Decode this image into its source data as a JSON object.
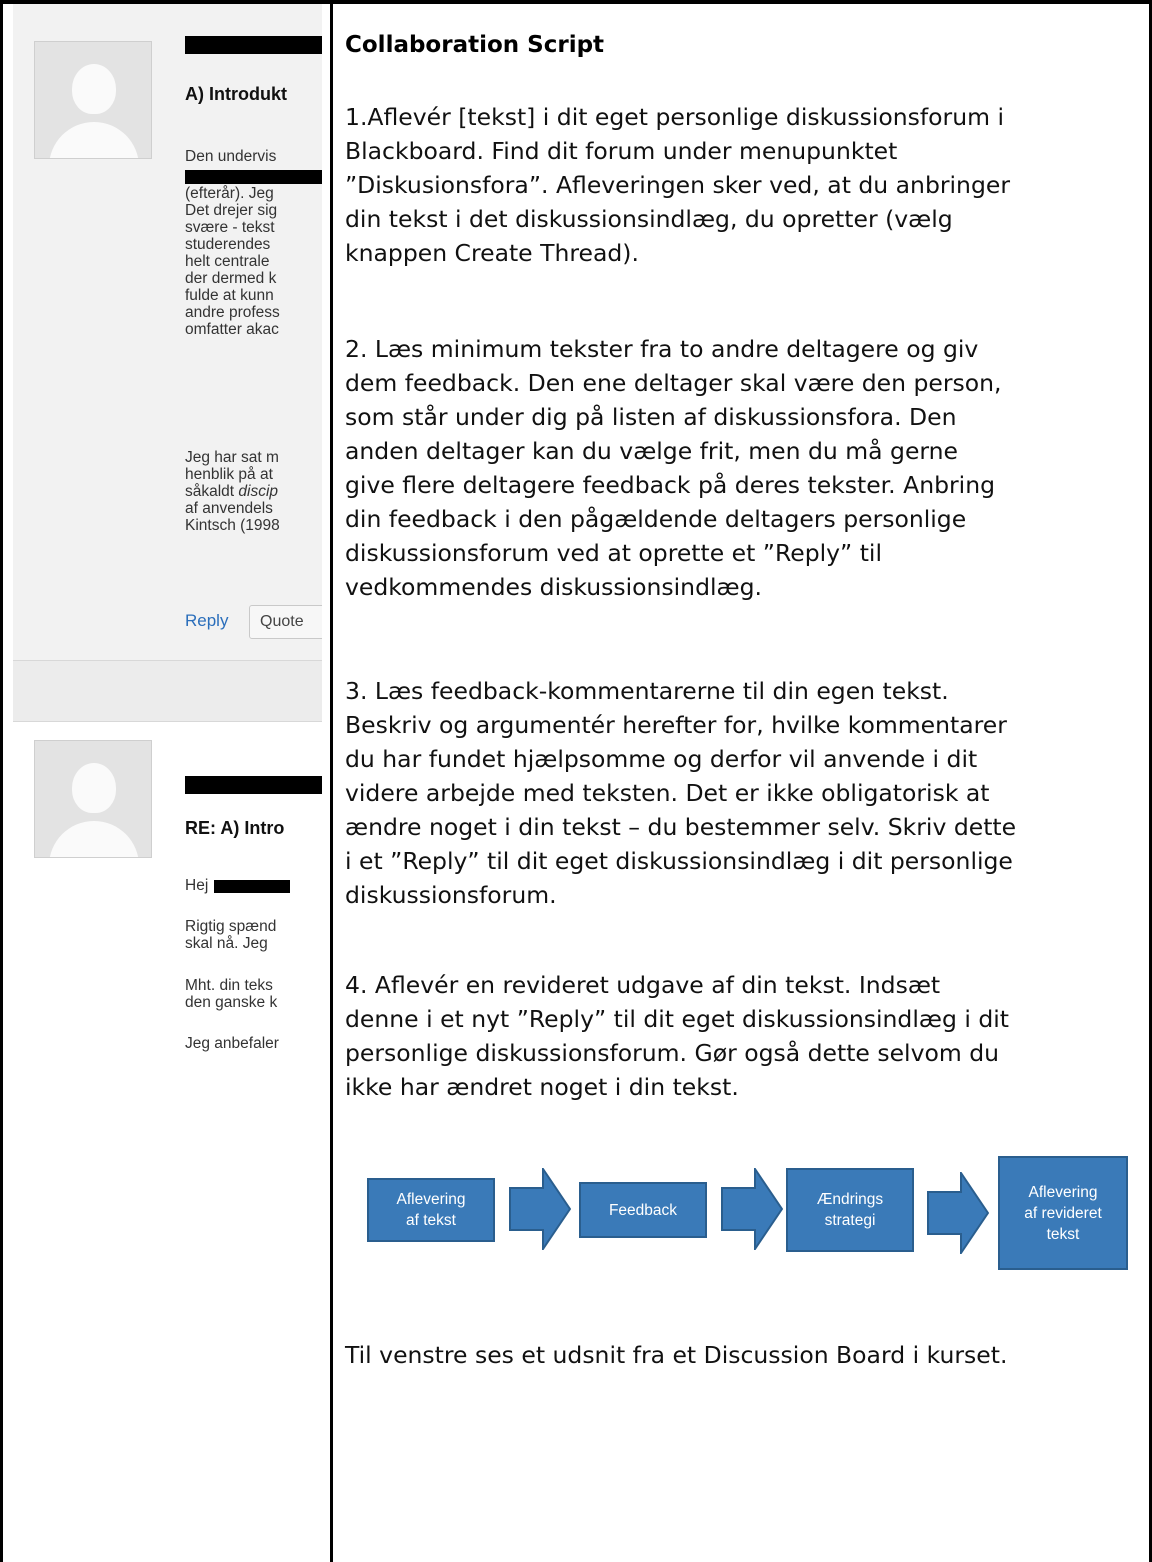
{
  "left_panel": {
    "post1": {
      "title": "A) Introdukt",
      "body_lines": [
        "Den undervis"
      ],
      "body_lines_2": [
        "(efterår). Jeg",
        "Det drejer sig",
        "svære - tekst",
        "studerendes",
        "helt centrale",
        "der dermed k",
        "fulde at kunn",
        "andre profess",
        "omfatter akac"
      ],
      "body_lines_3": [
        "Jeg har sat m",
        "henblik på at",
        "såkaldt ",
        "af anvendels",
        "Kintsch (1998"
      ],
      "italic_fragment": "discip",
      "reply_label": "Reply",
      "quote_label": "Quote"
    },
    "post2": {
      "title": "RE: A) Intro",
      "greeting": "Hej",
      "para1": [
        "Rigtig spænd",
        "skal nå. Jeg"
      ],
      "para2": [
        "Mht. din teks",
        "den ganske k"
      ],
      "para3": [
        "Jeg anbefaler"
      ]
    }
  },
  "right_panel": {
    "title": "Collaboration Script",
    "step1": [
      "1.Aflevér [tekst] i dit eget personlige diskussionsforum i",
      "Blackboard. Find dit forum under menupunktet",
      "”Diskusionsfora”.  Afleveringen sker ved, at du anbringer",
      "din tekst i det diskussionsindlæg, du opretter (vælg",
      "knappen Create Thread)."
    ],
    "step2": [
      "2. Læs minimum tekster fra to andre deltagere og giv",
      "dem feedback. Den ene deltager skal være den person,",
      "som står under dig på listen af diskussionsfora. Den",
      "anden deltager kan du vælge frit, men du må gerne",
      "give flere deltagere feedback på deres tekster. Anbring",
      "din feedback i den pågældende deltagers personlige",
      "diskussionsforum ved at oprette et ”Reply” til",
      "vedkommendes diskussionsindlæg."
    ],
    "step3": [
      "3. Læs feedback-kommentarerne til din egen tekst.",
      "Beskriv og argumentér herefter for, hvilke kommentarer",
      "du har fundet hjælpsomme og derfor vil anvende i dit",
      "videre arbejde med teksten. Det er ikke obligatorisk at",
      "ændre noget i din tekst – du bestemmer selv. Skriv dette",
      "i et ”Reply” til dit eget diskussionsindlæg i dit personlige",
      "diskussionsforum."
    ],
    "step4": [
      "4. Aflevér en revideret udgave af din tekst. Indsæt",
      "denne i et nyt ”Reply” til dit eget diskussionsindlæg i dit",
      "personlige diskussionsforum. Gør også dette selvom du",
      "ikke har ændret noget i din tekst."
    ],
    "flow": {
      "box1": [
        "Aflevering",
        "af tekst"
      ],
      "box2": [
        "Feedback"
      ],
      "box3": [
        "Ændrings",
        "strategi"
      ],
      "box4": [
        "Aflevering",
        "af revideret",
        "tekst"
      ]
    },
    "caption": "Til venstre ses et udsnit fra et Discussion Board i kurset."
  },
  "colors": {
    "flow_box": "#3a7ab8",
    "flow_border": "#2a5e8e",
    "reply_link": "#2a6ebb",
    "post_bg": "#f2f2f2"
  }
}
